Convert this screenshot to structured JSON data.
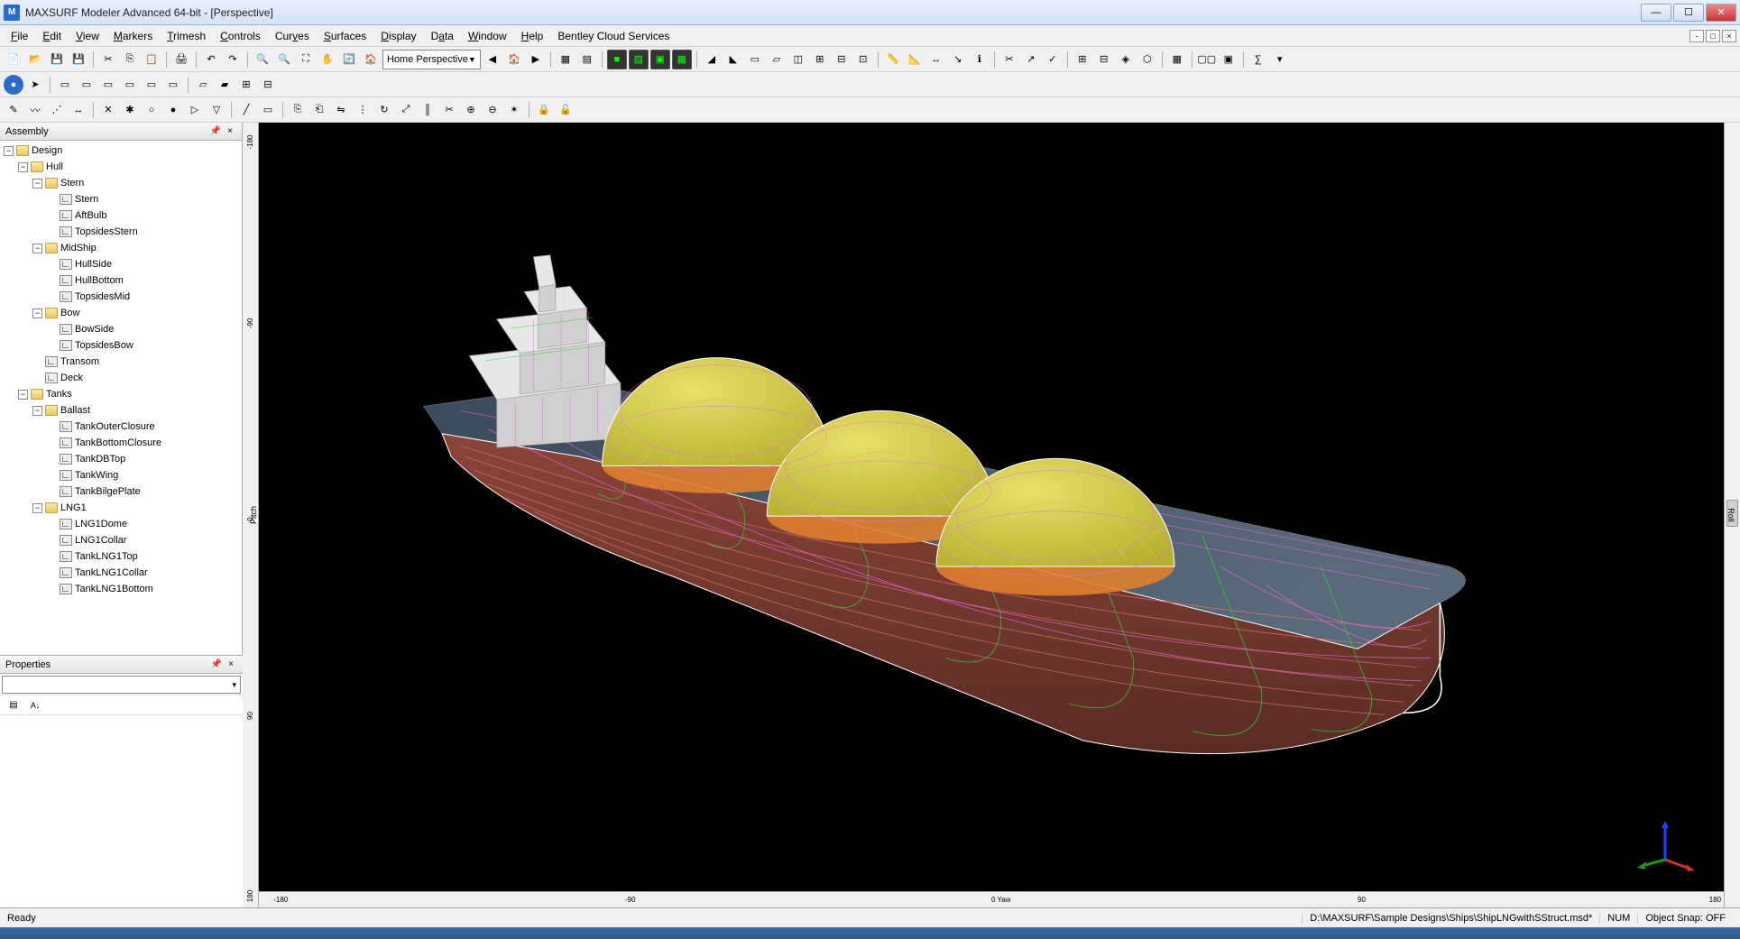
{
  "titlebar": {
    "app_icon_text": "M",
    "title": "MAXSURF Modeler Advanced 64-bit - [Perspective]"
  },
  "menubar": {
    "items": [
      {
        "label": "File",
        "u": 0
      },
      {
        "label": "Edit",
        "u": 0
      },
      {
        "label": "View",
        "u": 0
      },
      {
        "label": "Markers",
        "u": 0
      },
      {
        "label": "Trimesh",
        "u": 0
      },
      {
        "label": "Controls",
        "u": 0
      },
      {
        "label": "Curves",
        "u": 3
      },
      {
        "label": "Surfaces",
        "u": 0
      },
      {
        "label": "Display",
        "u": 0
      },
      {
        "label": "Data",
        "u": 1
      },
      {
        "label": "Window",
        "u": 0
      },
      {
        "label": "Help",
        "u": 0
      },
      {
        "label": "Bentley Cloud Services",
        "u": -1
      }
    ]
  },
  "toolbar1_combo": "Home Perspective",
  "panels": {
    "assembly_title": "Assembly",
    "properties_title": "Properties"
  },
  "tree": [
    {
      "d": 0,
      "t": "folder",
      "exp": true,
      "label": "Design"
    },
    {
      "d": 1,
      "t": "folder",
      "exp": true,
      "label": "Hull"
    },
    {
      "d": 2,
      "t": "folder",
      "exp": true,
      "label": "Stern"
    },
    {
      "d": 3,
      "t": "surf",
      "label": "Stern"
    },
    {
      "d": 3,
      "t": "surf",
      "label": "AftBulb"
    },
    {
      "d": 3,
      "t": "surf",
      "label": "TopsidesStern"
    },
    {
      "d": 2,
      "t": "folder",
      "exp": true,
      "label": "MidShip"
    },
    {
      "d": 3,
      "t": "surf",
      "label": "HullSide"
    },
    {
      "d": 3,
      "t": "surf",
      "label": "HullBottom"
    },
    {
      "d": 3,
      "t": "surf",
      "label": "TopsidesMid"
    },
    {
      "d": 2,
      "t": "folder",
      "exp": true,
      "label": "Bow"
    },
    {
      "d": 3,
      "t": "surf",
      "label": "BowSide"
    },
    {
      "d": 3,
      "t": "surf",
      "label": "TopsidesBow"
    },
    {
      "d": 2,
      "t": "surf",
      "label": "Transom"
    },
    {
      "d": 2,
      "t": "surf",
      "label": "Deck"
    },
    {
      "d": 1,
      "t": "folder",
      "exp": true,
      "label": "Tanks"
    },
    {
      "d": 2,
      "t": "folder",
      "exp": true,
      "label": "Ballast"
    },
    {
      "d": 3,
      "t": "surf",
      "label": "TankOuterClosure"
    },
    {
      "d": 3,
      "t": "surf",
      "label": "TankBottomClosure"
    },
    {
      "d": 3,
      "t": "surf",
      "label": "TankDBTop"
    },
    {
      "d": 3,
      "t": "surf",
      "label": "TankWing"
    },
    {
      "d": 3,
      "t": "surf",
      "label": "TankBilgePlate"
    },
    {
      "d": 2,
      "t": "folder",
      "exp": true,
      "label": "LNG1"
    },
    {
      "d": 3,
      "t": "surf",
      "label": "LNG1Dome"
    },
    {
      "d": 3,
      "t": "surf",
      "label": "LNG1Collar"
    },
    {
      "d": 3,
      "t": "surf",
      "label": "TankLNG1Top"
    },
    {
      "d": 3,
      "t": "surf",
      "label": "TankLNG1Collar"
    },
    {
      "d": 3,
      "t": "surf",
      "label": "TankLNG1Bottom"
    }
  ],
  "rulers": {
    "v_label": "Pitch",
    "v_right_label": "Roll",
    "v_ticks": [
      {
        "pos": 2,
        "label": "-180"
      },
      {
        "pos": 25,
        "label": "-90"
      },
      {
        "pos": 50,
        "label": "0"
      },
      {
        "pos": 75,
        "label": "90"
      },
      {
        "pos": 98,
        "label": "180"
      }
    ],
    "h_label": "0 Yaw",
    "h_ticks": [
      {
        "pos": 1,
        "label": "-180"
      },
      {
        "pos": 25,
        "label": "-90"
      },
      {
        "pos": 50,
        "label": "0 Yaw"
      },
      {
        "pos": 75,
        "label": "90"
      },
      {
        "pos": 99,
        "label": "180"
      }
    ]
  },
  "statusbar": {
    "ready": "Ready",
    "filepath": "D:\\MAXSURF\\Sample Designs\\Ships\\ShipLNGwithSStruct.msd*",
    "num": "NUM",
    "snap": "Object Snap: OFF"
  }
}
